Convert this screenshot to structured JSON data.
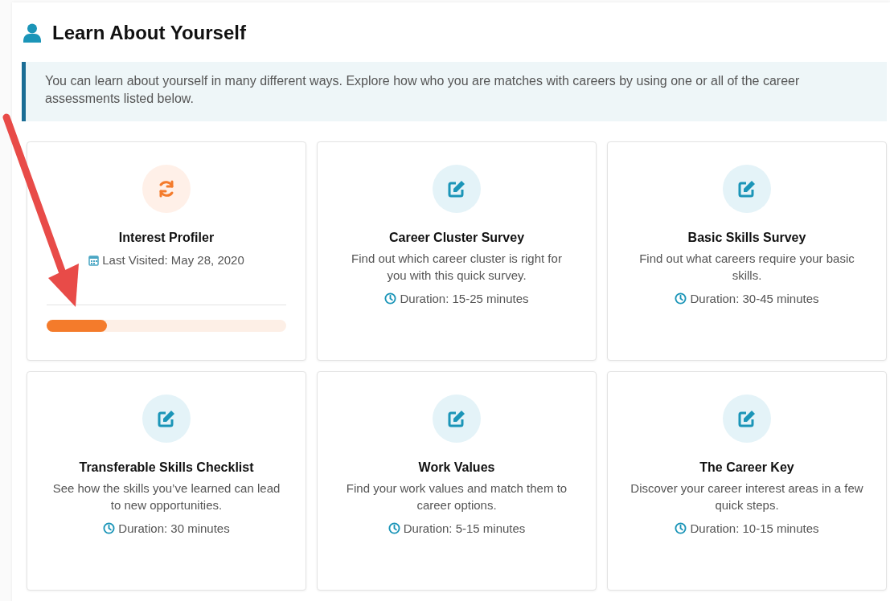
{
  "section": {
    "title": "Learn About Yourself"
  },
  "intro": "You can learn about yourself in many different ways. Explore how who you are matches with careers by using one or all of the career assessments listed below.",
  "cards": [
    {
      "kind": "progress",
      "title": "Interest Profiler",
      "visited": "Last Visited: May 28, 2020",
      "level": 0.25
    },
    {
      "kind": "new",
      "title": "Career Cluster Survey",
      "description": "Find out which career cluster is right for you with this quick survey.",
      "duration": "Duration: 15-25 minutes"
    },
    {
      "kind": "new",
      "title": "Basic Skills Survey",
      "description": "Find out what careers require your basic skills.",
      "duration": "Duration: 30-45 minutes"
    },
    {
      "kind": "new",
      "title": "Transferable Skills Checklist",
      "description": "See how the skills you’ve learned can lead to new opportunities.",
      "duration": "Duration: 30 minutes"
    },
    {
      "kind": "new",
      "title": "Work Values",
      "description": "Find your work values and match them to career options.",
      "duration": "Duration: 5-15 minutes"
    },
    {
      "kind": "new",
      "title": "The Career Key",
      "description": "Discover your career interest areas in a few quick steps.",
      "duration": "Duration: 10-15 minutes"
    }
  ]
}
